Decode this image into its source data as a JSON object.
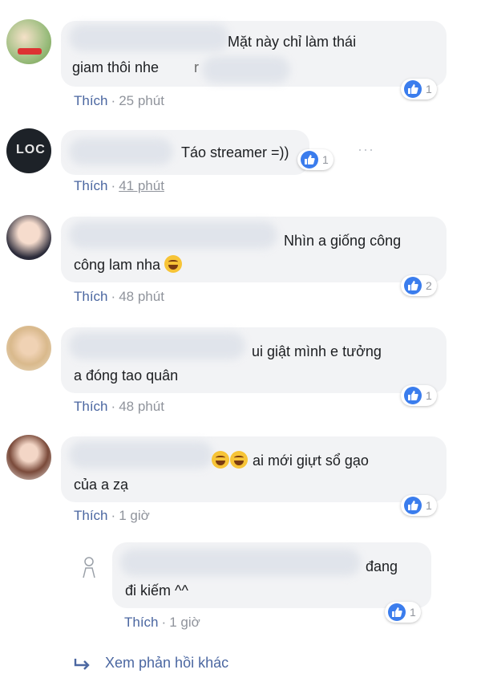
{
  "comments": [
    {
      "text": "Mặt này chỉ làm thái",
      "text2": "giam thôi nhe",
      "text2_tail": "r",
      "like": "Thích",
      "time": "25 phút",
      "reactions": "1"
    },
    {
      "text": "Táo streamer =))",
      "like": "Thích",
      "time": "41 phút",
      "reactions": "1",
      "avatar_label": "LOC"
    },
    {
      "text": "Nhìn a giống công",
      "text2": "công lam nha",
      "like": "Thích",
      "time": "48 phút",
      "reactions": "2"
    },
    {
      "text": "ui giật mình e tưởng",
      "text2": "a đóng tao quân",
      "like": "Thích",
      "time": "48 phút",
      "reactions": "1"
    },
    {
      "text": "ai mới giựt sổ gạo",
      "text2": "của a zạ",
      "like": "Thích",
      "time": "1 giờ",
      "reactions": "1"
    }
  ],
  "reply": {
    "text": "đang",
    "text2": "đi kiếm ^^",
    "like": "Thích",
    "time": "1 giờ",
    "reactions": "1"
  },
  "more_replies": "Xem phản hồi khác",
  "colors": {
    "bubble": "#f2f3f5",
    "link": "#4b67a1",
    "meta": "#90949c",
    "like_blue": "#3b7ded"
  }
}
